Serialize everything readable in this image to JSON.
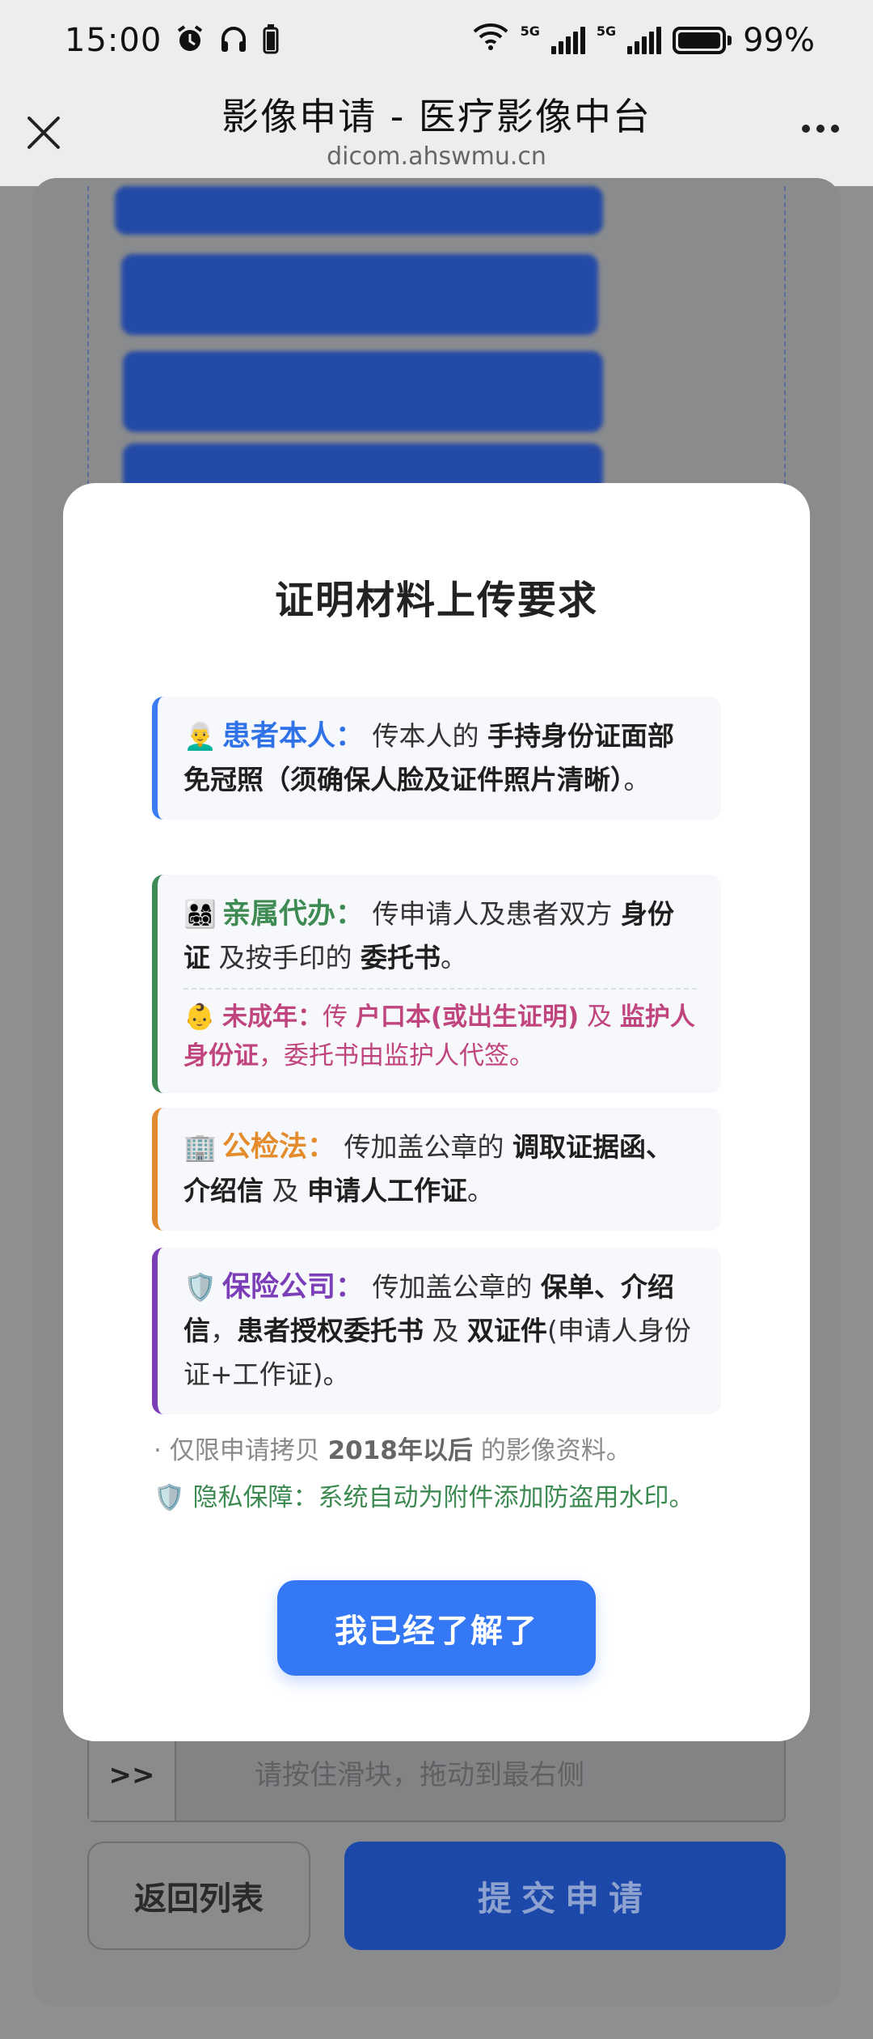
{
  "status_bar": {
    "time": "15:00",
    "icons": [
      "alarm-icon",
      "headphones-icon",
      "battery-small-icon",
      "wifi-icon",
      "signal-5g-icon",
      "signal-5g-icon"
    ],
    "net_label_1": "5G",
    "net_label_2": "5G",
    "battery_percent": "99%"
  },
  "browser": {
    "title": "影像申请 - 医疗影像中台",
    "url": "dicom.ahswmu.cn"
  },
  "background": {
    "slider_handle": ">>",
    "slider_hint": "请按住滑块，拖动到最右侧",
    "back_button": "返回列表",
    "submit_button": "提交申请"
  },
  "modal": {
    "title": "证明材料上传要求",
    "patient": {
      "emoji": "👨‍🦳",
      "label": "患者本人：",
      "text1": " 传本人的 ",
      "bold1": "手持身份证面部免冠照（须确保人脸及证件照片清晰）",
      "text2": "。"
    },
    "relative": {
      "emoji": "👨‍👩‍👧‍👦",
      "label": "亲属代办：",
      "text1": " 传申请人及患者双方 ",
      "bold1": "身份证",
      "text2": " 及按手印的 ",
      "bold2": "委托书",
      "text3": "。",
      "minor_emoji": "👶",
      "minor_label": "未成年：",
      "minor_text1": "传 ",
      "minor_bold1": "户口本(或出生证明)",
      "minor_text2": " 及 ",
      "minor_bold2": "监护人身份证",
      "minor_text3": "，委托书由监护人代签。"
    },
    "police": {
      "emoji": "🏢",
      "label": "公检法：",
      "text1": " 传加盖公章的 ",
      "bold1": "调取证据函、介绍信",
      "text2": " 及 ",
      "bold2": "申请人工作证",
      "text3": "。"
    },
    "insurance": {
      "emoji": "🛡️",
      "label": "保险公司：",
      "text1": " 传加盖公章的 ",
      "bold1": "保单、介绍信",
      "text2": "，",
      "bold2": "患者授权委托书",
      "text3": " 及 ",
      "bold3": "双证件",
      "text4": "(申请人身份证+工作证)。"
    },
    "note_year_pre": "· 仅限申请拷贝 ",
    "note_year_bold": "2018年以后",
    "note_year_post": " 的影像资料。",
    "note_privacy_emoji": "🛡️",
    "note_privacy": " 隐私保障：系统自动为附件添加防盗用水印。",
    "ack_button": "我已经了解了"
  },
  "colors": {
    "primary": "#3478f6",
    "patient": "#2f72e8",
    "relative": "#3d8a52",
    "minor": "#c0447e",
    "police": "#e48c2c",
    "insurance": "#7b3db8"
  }
}
